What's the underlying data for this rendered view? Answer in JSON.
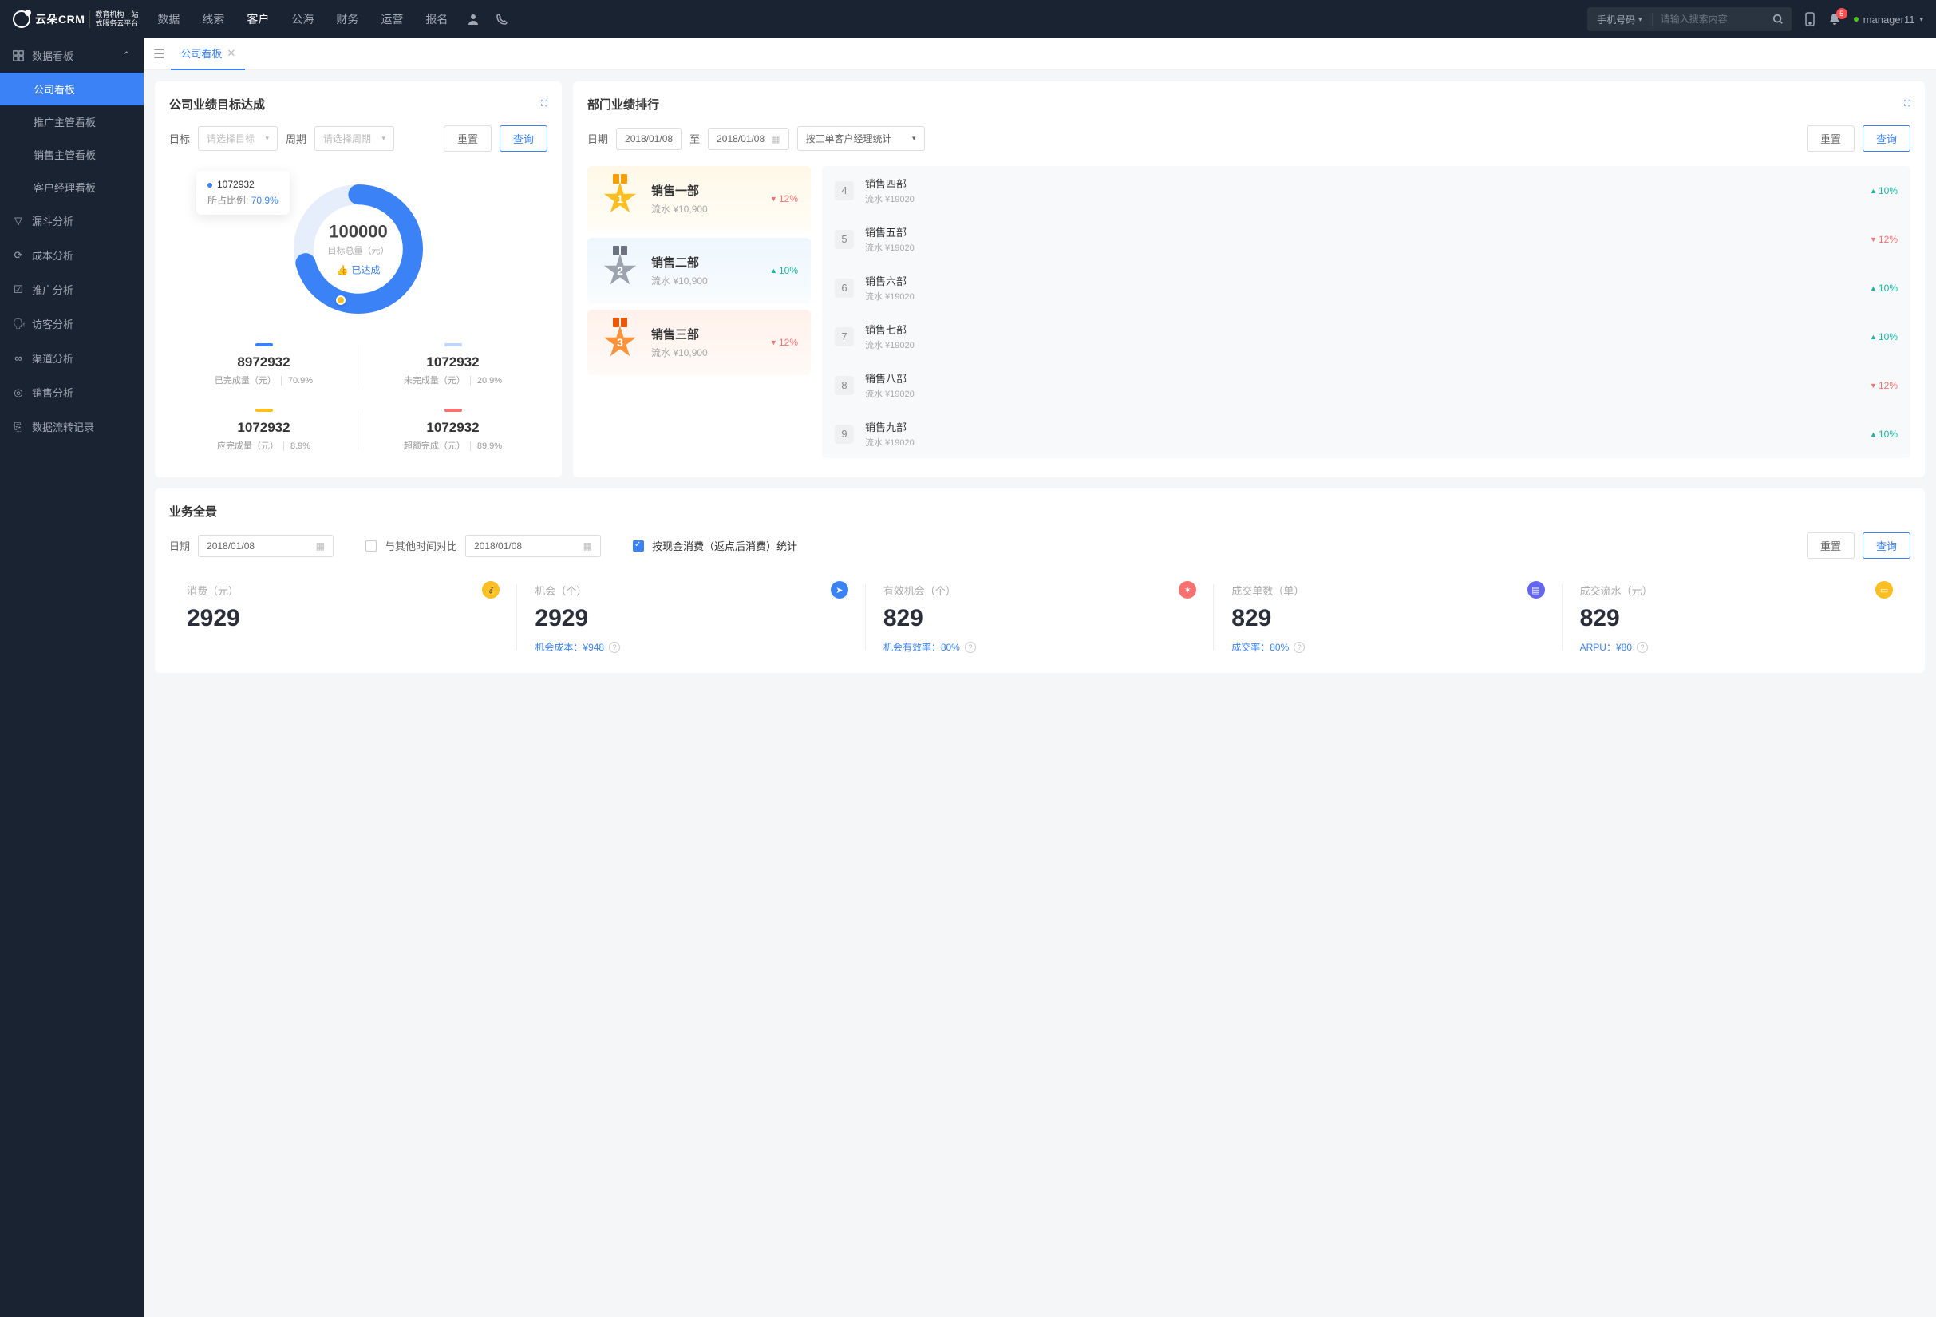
{
  "brand": {
    "name": "云朵CRM",
    "sub1": "教育机构一站",
    "sub2": "式服务云平台"
  },
  "nav": {
    "items": [
      "数据",
      "线索",
      "客户",
      "公海",
      "财务",
      "运营",
      "报名"
    ],
    "active": 2
  },
  "search": {
    "category": "手机号码",
    "placeholder": "请输入搜索内容"
  },
  "notif": {
    "count": "5"
  },
  "user": {
    "name": "manager11"
  },
  "sidebar": {
    "group": "数据看板",
    "items": [
      "公司看板",
      "推广主管看板",
      "销售主管看板",
      "客户经理看板"
    ],
    "active": 0,
    "rest": [
      "漏斗分析",
      "成本分析",
      "推广分析",
      "访客分析",
      "渠道分析",
      "销售分析",
      "数据流转记录"
    ]
  },
  "tab": {
    "label": "公司看板"
  },
  "target": {
    "title": "公司业绩目标达成",
    "labels": {
      "target": "目标",
      "period": "周期",
      "targetPh": "请选择目标",
      "periodPh": "请选择周期"
    },
    "reset": "重置",
    "query": "查询",
    "donut": {
      "total": "100000",
      "totalLabel": "目标总量（元）",
      "badge": "已达成"
    },
    "tooltip": {
      "val": "1072932",
      "ratioLabel": "所占比例:",
      "ratio": "70.9%"
    },
    "stats": [
      {
        "color": "#3b82f6",
        "val": "8972932",
        "label": "已完成量（元）",
        "pct": "70.9%"
      },
      {
        "color": "#bcd6ff",
        "val": "1072932",
        "label": "未完成量（元）",
        "pct": "20.9%"
      },
      {
        "color": "#fbbf24",
        "val": "1072932",
        "label": "应完成量（元）",
        "pct": "8.9%"
      },
      {
        "color": "#f87171",
        "val": "1072932",
        "label": "超额完成（元）",
        "pct": "89.9%"
      }
    ]
  },
  "rank": {
    "title": "部门业绩排行",
    "labels": {
      "date": "日期",
      "to": "至",
      "by": "按工单客户经理统计"
    },
    "date1": "2018/01/08",
    "date2": "2018/01/08",
    "reset": "重置",
    "query": "查询",
    "podium": [
      {
        "rank": "1",
        "name": "销售一部",
        "flow": "流水 ¥10,900",
        "chg": "12%",
        "dir": "down",
        "cls": "gold",
        "mc": "#fbbf24",
        "rc": "#f59e0b"
      },
      {
        "rank": "2",
        "name": "销售二部",
        "flow": "流水 ¥10,900",
        "chg": "10%",
        "dir": "up",
        "cls": "silver",
        "mc": "#9ca3af",
        "rc": "#6b7280"
      },
      {
        "rank": "3",
        "name": "销售三部",
        "flow": "流水 ¥10,900",
        "chg": "12%",
        "dir": "down",
        "cls": "bronze",
        "mc": "#fb923c",
        "rc": "#ea580c"
      }
    ],
    "list": [
      {
        "no": "4",
        "name": "销售四部",
        "flow": "流水 ¥19020",
        "chg": "10%",
        "dir": "up"
      },
      {
        "no": "5",
        "name": "销售五部",
        "flow": "流水 ¥19020",
        "chg": "12%",
        "dir": "down"
      },
      {
        "no": "6",
        "name": "销售六部",
        "flow": "流水 ¥19020",
        "chg": "10%",
        "dir": "up"
      },
      {
        "no": "7",
        "name": "销售七部",
        "flow": "流水 ¥19020",
        "chg": "10%",
        "dir": "up"
      },
      {
        "no": "8",
        "name": "销售八部",
        "flow": "流水 ¥19020",
        "chg": "12%",
        "dir": "down"
      },
      {
        "no": "9",
        "name": "销售九部",
        "flow": "流水 ¥19020",
        "chg": "10%",
        "dir": "up"
      }
    ]
  },
  "overview": {
    "title": "业务全景",
    "labels": {
      "date": "日期",
      "compare": "与其他时间对比",
      "stat": "按现金消费（返点后消费）统计"
    },
    "date1": "2018/01/08",
    "date2": "2018/01/08",
    "reset": "重置",
    "query": "查询",
    "kpis": [
      {
        "label": "消费（元）",
        "val": "2929",
        "foot": "",
        "color": "#fbbf24",
        "icon": "💰"
      },
      {
        "label": "机会（个）",
        "val": "2929",
        "footLabel": "机会成本：",
        "footVal": "¥948",
        "color": "#3b82f6",
        "icon": "➤"
      },
      {
        "label": "有效机会（个）",
        "val": "829",
        "footLabel": "机会有效率：",
        "footVal": "80%",
        "color": "#f87171",
        "icon": "✶"
      },
      {
        "label": "成交单数（单）",
        "val": "829",
        "footLabel": "成交率：",
        "footVal": "80%",
        "color": "#6366f1",
        "icon": "▤"
      },
      {
        "label": "成交流水（元）",
        "val": "829",
        "footLabel": "ARPU：",
        "footVal": "¥80",
        "color": "#fbbf24",
        "icon": "▭"
      }
    ]
  },
  "chart_data": {
    "type": "pie",
    "title": "公司业绩目标达成",
    "total": 100000,
    "series": [
      {
        "name": "已完成量（元）",
        "value": 8972932,
        "pct": 70.9,
        "color": "#3b82f6"
      },
      {
        "name": "未完成量（元）",
        "value": 1072932,
        "pct": 20.9,
        "color": "#bcd6ff"
      },
      {
        "name": "应完成量（元）",
        "value": 1072932,
        "pct": 8.9,
        "color": "#fbbf24"
      },
      {
        "name": "超额完成（元）",
        "value": 1072932,
        "pct": 89.9,
        "color": "#f87171"
      }
    ]
  }
}
